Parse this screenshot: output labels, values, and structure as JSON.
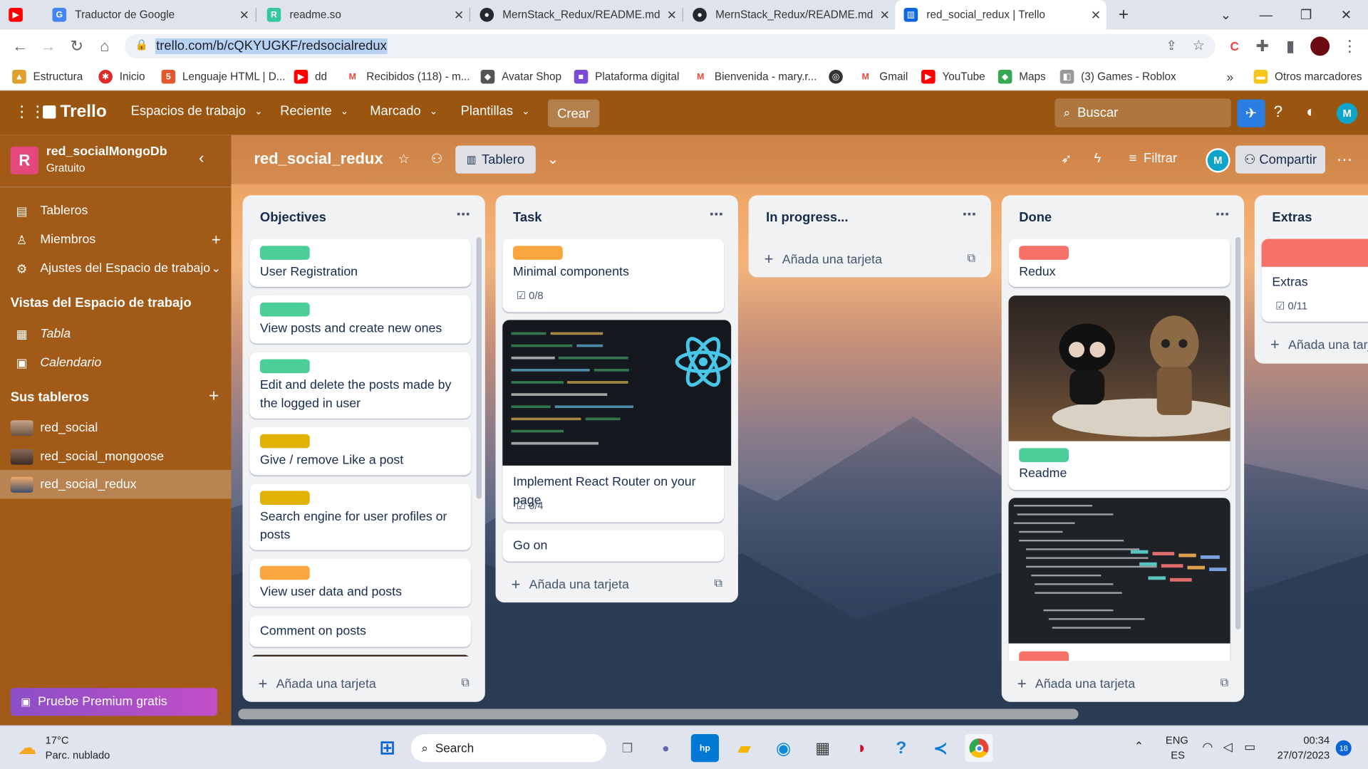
{
  "browser": {
    "tabs": [
      {
        "title": "Traductor de Google",
        "active": false
      },
      {
        "title": "readme.so",
        "active": false
      },
      {
        "title": "MernStack_Redux/README.md a",
        "active": false
      },
      {
        "title": "MernStack_Redux/README.md a",
        "active": false
      },
      {
        "title": "red_social_redux | Trello",
        "active": true
      }
    ],
    "url": "trello.com/b/cQKYUGKF/redsocialredux",
    "bookmarks": [
      "Estructura",
      "Inicio",
      "Lenguaje HTML | D...",
      "dd",
      "Recibidos (118) - m...",
      "Avatar Shop",
      "Plataforma digital",
      "Bienvenida - mary.r...",
      "Gmail",
      "YouTube",
      "Maps",
      "(3) Games - Roblox"
    ],
    "other_bookmarks": "Otros marcadores"
  },
  "trello_header": {
    "logo": "Trello",
    "menu": [
      "Espacios de trabajo",
      "Reciente",
      "Marcado",
      "Plantillas"
    ],
    "create": "Crear",
    "search_placeholder": "Buscar",
    "avatar": "M"
  },
  "sidebar": {
    "workspace_initial": "R",
    "workspace_name": "red_socialMongoDb",
    "workspace_plan": "Gratuito",
    "items": [
      "Tableros",
      "Miembros",
      "Ajustes del Espacio de trabajo"
    ],
    "views_heading": "Vistas del Espacio de trabajo",
    "views": [
      "Tabla",
      "Calendario"
    ],
    "boards_heading": "Sus tableros",
    "boards": [
      "red_social",
      "red_social_mongoose",
      "red_social_redux"
    ],
    "premium": "Pruebe Premium gratis"
  },
  "board": {
    "title": "red_social_redux",
    "view": "Tablero",
    "filter": "Filtrar",
    "share": "Compartir",
    "member": "M",
    "add_card": "Añada una tarjeta",
    "lists": [
      {
        "title": "Objectives",
        "cards": [
          {
            "label": "#4bce97",
            "text": "User Registration"
          },
          {
            "label": "#4bce97",
            "text": "View posts and create new ones"
          },
          {
            "label": "#4bce97",
            "text": "Edit and delete the posts made by the logged in user"
          },
          {
            "label": "#e2b203",
            "text": "Give / remove Like a post"
          },
          {
            "label": "#e2b203",
            "text": "Search engine for user profiles or posts"
          },
          {
            "label": "#faa53d",
            "text": "View user data and posts"
          },
          {
            "label": "",
            "text": "Comment on posts"
          }
        ]
      },
      {
        "title": "Task",
        "cards": [
          {
            "label": "#faa53d",
            "text": "Minimal components",
            "checklist": "0/8"
          },
          {
            "label": "",
            "text": "Implement React Router on your page",
            "checklist": "0/4"
          },
          {
            "label": "",
            "text": "Go on"
          }
        ]
      },
      {
        "title": "In progress...",
        "cards": []
      },
      {
        "title": "Done",
        "cards": [
          {
            "label": "#f87168",
            "text": "Redux"
          },
          {
            "label": "#4bce97",
            "text": "Readme"
          }
        ]
      },
      {
        "title": "Extras",
        "cards": [
          {
            "label": "#f87168",
            "text": "Extras",
            "checklist": "0/11"
          }
        ]
      }
    ]
  },
  "taskbar": {
    "weather_temp": "17°C",
    "weather_desc": "Parc. nublado",
    "search": "Search",
    "lang1": "ENG",
    "lang2": "ES",
    "time": "00:34",
    "date": "27/07/2023",
    "notif": "18"
  }
}
